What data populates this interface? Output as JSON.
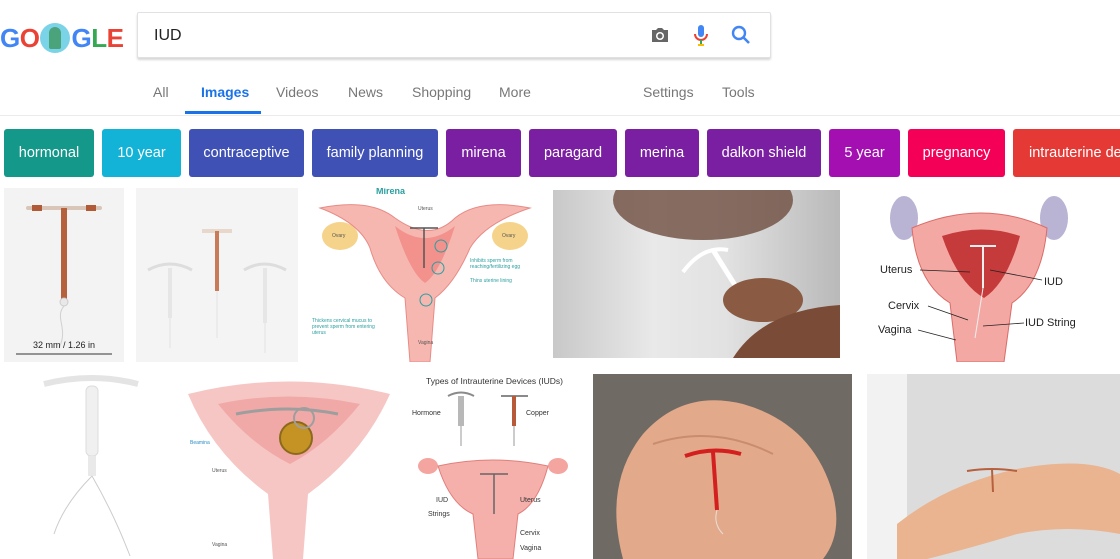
{
  "logo": {
    "letters": [
      "G",
      "O",
      "G",
      "L",
      "E"
    ]
  },
  "search": {
    "query": "IUD"
  },
  "tabs": {
    "all": "All",
    "images": "Images",
    "videos": "Videos",
    "news": "News",
    "shopping": "Shopping",
    "more": "More",
    "settings": "Settings",
    "tools": "Tools"
  },
  "chips": [
    {
      "label": "hormonal",
      "color": "#13988a"
    },
    {
      "label": "10 year",
      "color": "#12b3d6"
    },
    {
      "label": "contraceptive",
      "color": "#3f51b5"
    },
    {
      "label": "family planning",
      "color": "#3f51b5"
    },
    {
      "label": "mirena",
      "color": "#7b1fa2"
    },
    {
      "label": "paragard",
      "color": "#7b1fa2"
    },
    {
      "label": "merina",
      "color": "#7b1fa2"
    },
    {
      "label": "dalkon shield",
      "color": "#7b1fa2"
    },
    {
      "label": "5 year",
      "color": "#a40fb2"
    },
    {
      "label": "pregnancy",
      "color": "#f50057"
    },
    {
      "label": "intrauterine device",
      "color": "#e53935"
    }
  ],
  "results": {
    "img1": {
      "caption": "32 mm / 1.26 in"
    },
    "img3": {
      "title": "Mirena",
      "uterus": "Uterus",
      "ovary_l": "Ovary",
      "ovary_r": "Ovary",
      "note1": "Inhibits sperm from reaching/fertilizing egg",
      "note2": "Thins uterine lining",
      "note3": "Thickens cervical mucus to prevent sperm from entering uterus",
      "vagina": "Vagina"
    },
    "img5": {
      "uterus": "Uterus",
      "iud": "IUD",
      "cervix": "Cervix",
      "iud_string": "IUD String",
      "vagina": "Vagina"
    },
    "img7": {
      "brand": "Beamina",
      "uterus": "Uterus",
      "vagina": "Vagina"
    },
    "img8": {
      "title": "Types of Intrauterine Devices (IUDs)",
      "hormone": "Hormone",
      "copper": "Copper",
      "iud": "IUD",
      "strings": "Strings",
      "uterus": "Uterus",
      "cervix": "Cervix",
      "vagina": "Vagina"
    }
  }
}
